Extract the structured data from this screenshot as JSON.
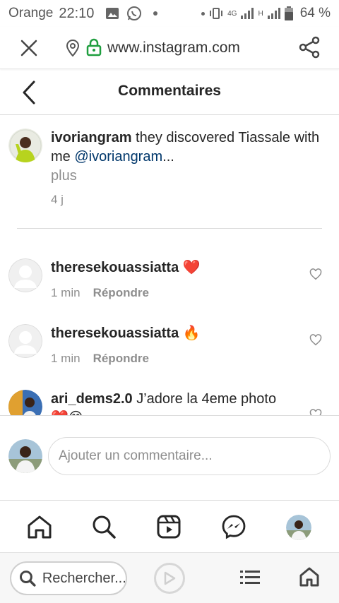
{
  "status_bar": {
    "carrier": "Orange",
    "time": "22:10",
    "network": "4G",
    "network_small": "H",
    "battery": "64 %"
  },
  "browser": {
    "url": "www.instagram.com"
  },
  "header": {
    "title": "Commentaires"
  },
  "caption": {
    "username": "ivoriangram",
    "text": " they discovered Tiassale with me ",
    "mention": "@ivoriangram",
    "ellipsis": "...",
    "more_label": "plus",
    "age": "4 j"
  },
  "comments": [
    {
      "username": "theresekouassiatta",
      "text": " ❤️",
      "time": "1 min",
      "reply_label": "Répondre"
    },
    {
      "username": "theresekouassiatta",
      "text": " 🔥",
      "time": "1 min",
      "reply_label": "Répondre"
    },
    {
      "username": "ari_dems2.0",
      "text": " J’adore la 4eme photo",
      "text_line2": "❤️😊"
    }
  ],
  "add_comment": {
    "placeholder": "Ajouter un commentaire..."
  },
  "browser_bottom": {
    "search_label": "Rechercher..."
  },
  "colors": {
    "mention": "#00376b",
    "muted": "#8e8e8e",
    "lock_green": "#1e9e3e"
  },
  "icons": {
    "close": "close-icon",
    "location": "location-pin-icon",
    "lock": "lock-icon",
    "share": "share-icon",
    "back": "chevron-left-icon",
    "like": "heart-outline-icon",
    "home": "home-icon",
    "search": "search-icon",
    "reels": "reels-icon",
    "messenger": "messenger-icon"
  }
}
